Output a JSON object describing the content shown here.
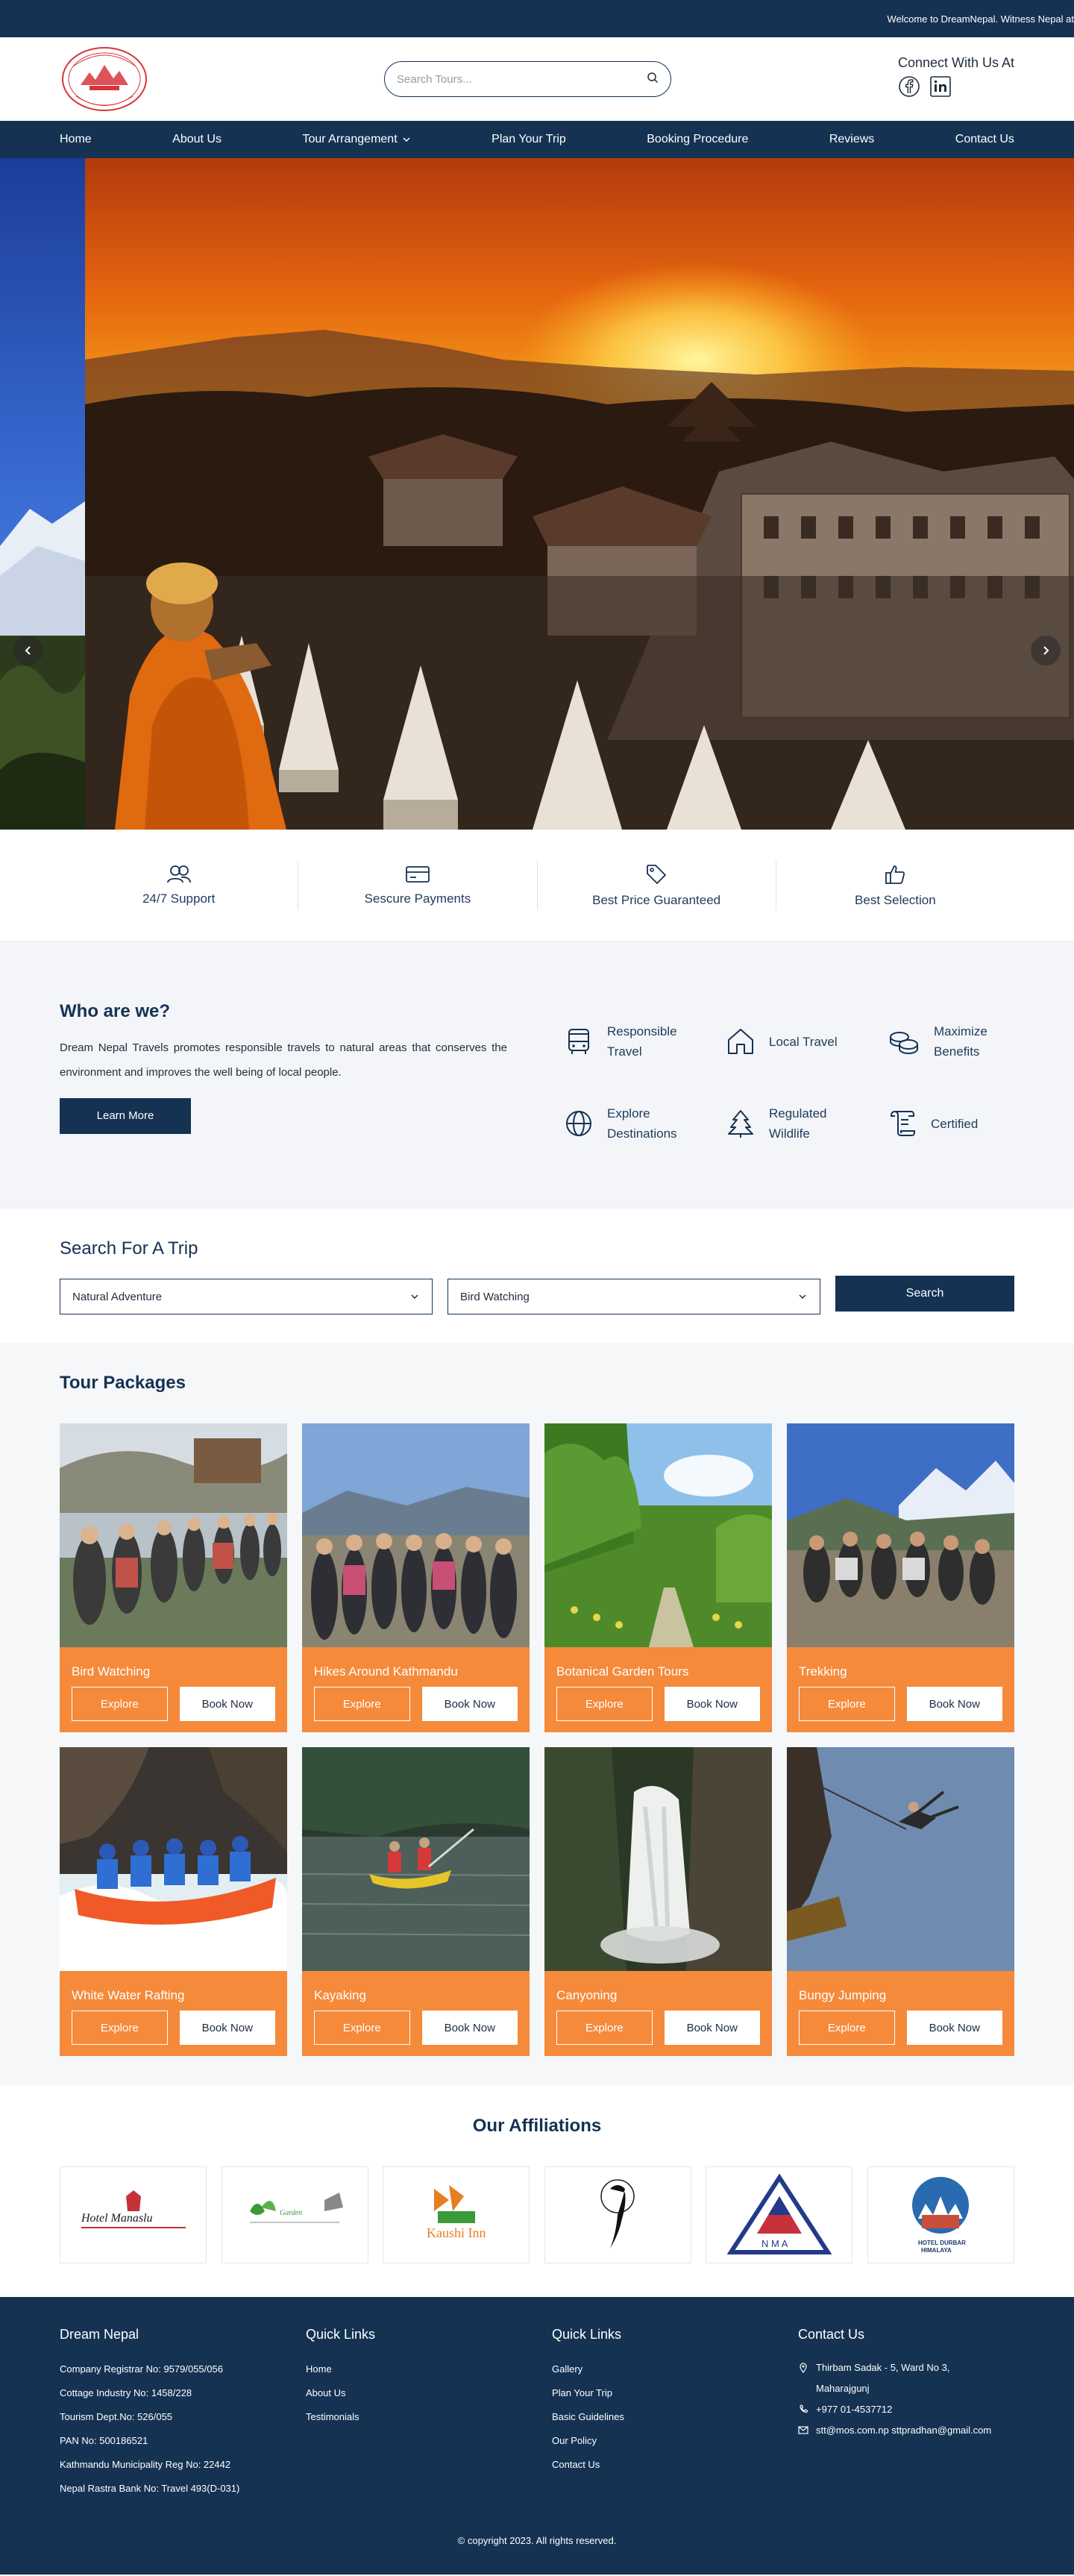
{
  "topbar": {
    "message": "Welcome to DreamNepal. Witness Nepal at"
  },
  "header": {
    "search_placeholder": "Search Tours...",
    "connect_title": "Connect With Us At",
    "social": [
      "facebook-icon",
      "linkedin-icon"
    ]
  },
  "nav": {
    "items": [
      "Home",
      "About Us",
      "Tour Arrangement",
      "Plan Your Trip",
      "Booking Procedure",
      "Reviews",
      "Contact Us"
    ]
  },
  "features": [
    {
      "icon": "users-icon",
      "label": "24/7 Support"
    },
    {
      "icon": "credit-card-icon",
      "label": "Sescure Payments"
    },
    {
      "icon": "tag-icon",
      "label": "Best Price Guaranteed"
    },
    {
      "icon": "thumbs-up-icon",
      "label": "Best Selection"
    }
  ],
  "who": {
    "title": "Who are we?",
    "text": "Dream Nepal Travels promotes responsible travels to natural areas that conserves the environment and improves the well being of local people.",
    "button": "Learn More",
    "items": [
      {
        "icon": "bus-icon",
        "label": "Responsible Travel"
      },
      {
        "icon": "home-icon",
        "label": "Local Travel"
      },
      {
        "icon": "coins-icon",
        "label": "Maximize Benefits"
      },
      {
        "icon": "globe-icon",
        "label": "Explore Destinations"
      },
      {
        "icon": "tree-icon",
        "label": "Regulated Wildlife"
      },
      {
        "icon": "scroll-icon",
        "label": "Certified"
      }
    ]
  },
  "trip": {
    "title": "Search For A Trip",
    "select1": "Natural Adventure",
    "select2": "Bird Watching",
    "button": "Search"
  },
  "tours": {
    "title": "Tour Packages",
    "explore_label": "Explore",
    "book_label": "Book Now",
    "items": [
      {
        "title": "Bird Watching",
        "scene": "group"
      },
      {
        "title": "Hikes Around Kathmandu",
        "scene": "group-mountain"
      },
      {
        "title": "Botanical Garden Tours",
        "scene": "garden"
      },
      {
        "title": "Trekking",
        "scene": "trek"
      },
      {
        "title": "White Water Rafting",
        "scene": "raft"
      },
      {
        "title": "Kayaking",
        "scene": "kayak"
      },
      {
        "title": "Canyoning",
        "scene": "waterfall"
      },
      {
        "title": "Bungy Jumping",
        "scene": "bungy"
      }
    ]
  },
  "affiliations": {
    "title": "Our Affiliations",
    "logos": [
      "Hotel Manaslu",
      "Garden Logo",
      "Gurdsdur Kaushi Inn",
      "Bird Logo",
      "NMA",
      "Hotel Durbar Himalaya"
    ]
  },
  "footer": {
    "col1": {
      "title": "Dream Nepal",
      "lines": [
        "Company Registrar No: 9579/055/056",
        "Cottage Industry No: 1458/228",
        "Tourism Dept.No: 526/055",
        "PAN No: 500186521",
        "Kathmandu Municipality Reg No: 22442",
        "Nepal Rastra Bank No: Travel 493(D-031)"
      ]
    },
    "col2": {
      "title": "Quick Links",
      "links": [
        "Home",
        "About Us",
        "Testimonials"
      ]
    },
    "col3": {
      "title": "Quick Links",
      "links": [
        "Gallery",
        "Plan Your Trip",
        "Basic Guidelines",
        "Our Policy",
        "Contact Us"
      ]
    },
    "col4": {
      "title": "Contact Us",
      "address": "Thirbam Sadak - 5, Ward No 3, Maharajgunj",
      "phone": "+977 01-4537712",
      "email": "stt@mos.com.np sttpradhan@gmail.com"
    },
    "copyright": "© copyright 2023. All rights reserved."
  },
  "colors": {
    "navy": "#153253",
    "orange": "#f58a3b"
  }
}
